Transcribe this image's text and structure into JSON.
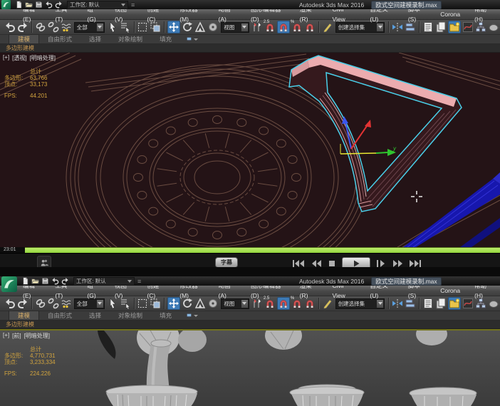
{
  "window": {
    "app_title": "Autodesk 3ds Max 2016",
    "doc_title": "欧式空间建模录制.max",
    "workspace": "工作区: 默认"
  },
  "menubar": {
    "items": [
      "编辑(E)",
      "工具(T)",
      "组(G)",
      "视图(V)",
      "创建(C)",
      "修改器(M)",
      "动画(A)",
      "图形编辑器(D)",
      "渲染(R)",
      "Civil View",
      "自定义(U)",
      "脚本(S)",
      "Corona",
      "帮助(H)"
    ]
  },
  "toolbar": {
    "selection_filter": "全部",
    "reference_coordinate": "视图",
    "named_selection_set": "创建选择集",
    "snap_label": "2.5",
    "percent_label": "%"
  },
  "ribbon": {
    "tabs": [
      "建模",
      "自由形式",
      "选择",
      "对象绘制",
      "填充"
    ],
    "subtab": "多边形建模"
  },
  "viewport_top": {
    "label_menu": "[+]",
    "label_view": "[透视]",
    "label_shading": "[明暗处理]",
    "stats": {
      "total": "总计",
      "poly_label": "多边形:",
      "poly": "63,766",
      "vert_label": "顶点:",
      "vert": "33,173",
      "fps_label": "FPS:",
      "fps": "44.201"
    },
    "axis_y": "y"
  },
  "viewport_bottom": {
    "label_menu": "[+]",
    "label_view": "[前]",
    "label_shading": "[明暗处理]",
    "stats": {
      "total": "总计",
      "poly_label": "多边形:",
      "poly": "4,770,731",
      "vert_label": "顶点:",
      "vert": "3,233,334",
      "fps_label": "FPS:",
      "fps": "224.226"
    }
  },
  "player": {
    "time": "23:01",
    "subtitle": "字幕"
  },
  "icon_names": [
    "max-logo",
    "new-file",
    "open-file",
    "save-file",
    "undo",
    "redo",
    "select-and-link",
    "unlink-selection",
    "bind-to-space-warp",
    "select-object",
    "select-by-name",
    "rectangular-selection-region",
    "window-crossing",
    "select-and-move",
    "select-and-rotate",
    "select-and-scale",
    "use-center",
    "select-and-place",
    "snap-toggle",
    "angle-snap",
    "percent-snap",
    "spinner-snap",
    "keyboard-override",
    "mirror",
    "align",
    "layer-list",
    "duplicate-sheets",
    "scene-explorer",
    "curve-editor",
    "schematic-view",
    "render-setup",
    "ribbon-monitor",
    "people",
    "subtitle",
    "skip-start",
    "rewind",
    "stop",
    "play",
    "frame-step",
    "fast-forward",
    "skip-end"
  ],
  "colors": {
    "selection_pink": "#ecacaf",
    "selection_outline": "#49cfe9",
    "viewport_maroon": "#241316",
    "wireframe": "#6a4c41",
    "progress_green": "#9fdf4a",
    "highlight_blue": "#3d7ab5",
    "stats_orange": "#d2a43e",
    "navy_object": "#1717ad"
  }
}
